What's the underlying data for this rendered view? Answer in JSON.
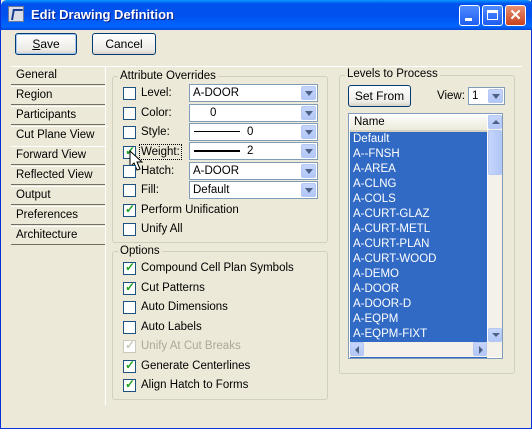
{
  "window": {
    "title": "Edit Drawing Definition"
  },
  "titlebar": {
    "minimize": "minimize",
    "maximize": "maximize",
    "close": "close"
  },
  "toolbar": {
    "save_label": "Save",
    "cancel_label": "Cancel"
  },
  "tabs": [
    "General",
    "Region",
    "Participants",
    "Cut Plane View",
    "Forward View",
    "Reflected View",
    "Output",
    "Preferences",
    "Architecture"
  ],
  "selected_tab": "Cut Plane View",
  "attribute_overrides": {
    "label": "Attribute Overrides",
    "level": {
      "label": "Level:",
      "value": "A-DOOR",
      "checked": false
    },
    "color": {
      "label": "Color:",
      "value": "0",
      "checked": false
    },
    "style": {
      "label": "Style:",
      "value": "0",
      "checked": false
    },
    "weight": {
      "label": "Weight:",
      "value": "2",
      "checked": true
    },
    "hatch": {
      "label": "Hatch:",
      "value": "A-DOOR",
      "checked": false
    },
    "fill": {
      "label": "Fill:",
      "value": "Default",
      "checked": false
    },
    "perform_unification": {
      "label": "Perform Unification",
      "checked": true
    },
    "unify_all": {
      "label": "Unify All",
      "checked": false
    }
  },
  "options": {
    "label": "Options",
    "compound_cell": {
      "label": "Compound Cell Plan Symbols",
      "checked": true
    },
    "cut_patterns": {
      "label": "Cut Patterns",
      "checked": true
    },
    "auto_dimensions": {
      "label": "Auto Dimensions",
      "checked": false
    },
    "auto_labels": {
      "label": "Auto Labels",
      "checked": false
    },
    "unify_at_cut_breaks": {
      "label": "Unify At Cut Breaks",
      "checked": true,
      "disabled": true
    },
    "generate_centerlines": {
      "label": "Generate Centerlines",
      "checked": true
    },
    "align_hatch": {
      "label": "Align Hatch to Forms",
      "checked": true
    }
  },
  "levels": {
    "label": "Levels to Process",
    "set_from_label": "Set From",
    "view_label": "View:",
    "view_value": "1",
    "column_header": "Name",
    "items": [
      "Default",
      "A--FNSH",
      "A-AREA",
      "A-CLNG",
      "A-COLS",
      "A-CURT-GLAZ",
      "A-CURT-METL",
      "A-CURT-PLAN",
      "A-CURT-WOOD",
      "A-DEMO",
      "A-DOOR",
      "A-DOOR-D",
      "A-EQPM",
      "A-EQPM-FIXT"
    ]
  },
  "colors": {
    "titlebar": "#0054e3",
    "selection": "#316ac5",
    "dialog_bg": "#ece9d8"
  }
}
